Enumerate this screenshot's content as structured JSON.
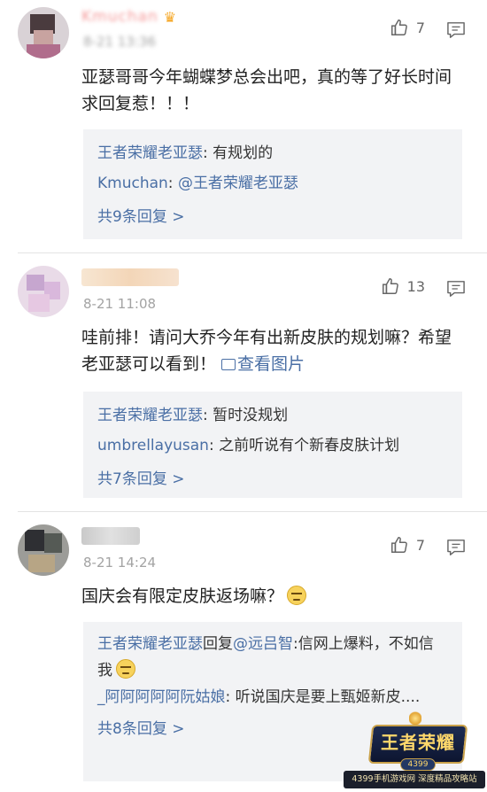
{
  "comments": [
    {
      "user_name": "Kmuchan",
      "time": "8-21 13:36",
      "likes": "7",
      "text": "亚瑟哥哥今年蝴蝶梦总会出吧，真的等了好长时间求回复惹！！！",
      "replies": [
        {
          "user": "王者荣耀老亚瑟",
          "sep": ": ",
          "text": "有规划的"
        },
        {
          "user": "Kmuchan",
          "sep": ": ",
          "text": "@王者荣耀老亚瑟"
        }
      ],
      "more": "共9条回复 >"
    },
    {
      "time": "8-21 11:08",
      "likes": "13",
      "text": "哇前排！请问大乔今年有出新皮肤的规划嘛？希望老亚瑟可以看到！",
      "image_link": "查看图片",
      "replies": [
        {
          "user": "王者荣耀老亚瑟",
          "sep": ": ",
          "text": "暂时没规划"
        },
        {
          "user": "umbrellayusan",
          "sep": ": ",
          "text": "之前听说有个新春皮肤计划"
        }
      ],
      "more": "共7条回复 >"
    },
    {
      "time": "8-21 14:24",
      "likes": "7",
      "text": "国庆会有限定皮肤返场嘛？",
      "replies": [
        {
          "user": "王者荣耀老亚瑟",
          "mid": "回复",
          "mention": "@远吕智",
          "text": ":信网上爆料，不如信我"
        },
        {
          "user": "_阿阿阿阿阿阮姑娘",
          "sep": ": ",
          "text": "听说国庆是要上甄姬新皮...."
        }
      ],
      "more": "共8条回复 >"
    }
  ],
  "watermark": {
    "logo_text": "王者荣耀",
    "logo_sub": "4399",
    "banner": "4399手机游戏网 深度精品攻略站"
  },
  "icons": {
    "like": "thumbs-up-icon",
    "reply": "comment-bubble-icon",
    "image": "picture-icon",
    "emoji": "grimace-emoji-icon",
    "crown": "crown-icon"
  },
  "colors": {
    "link_blue": "#4a6fa5",
    "sub_bg": "#f2f3f5",
    "time_gray": "#a3a3a3"
  }
}
